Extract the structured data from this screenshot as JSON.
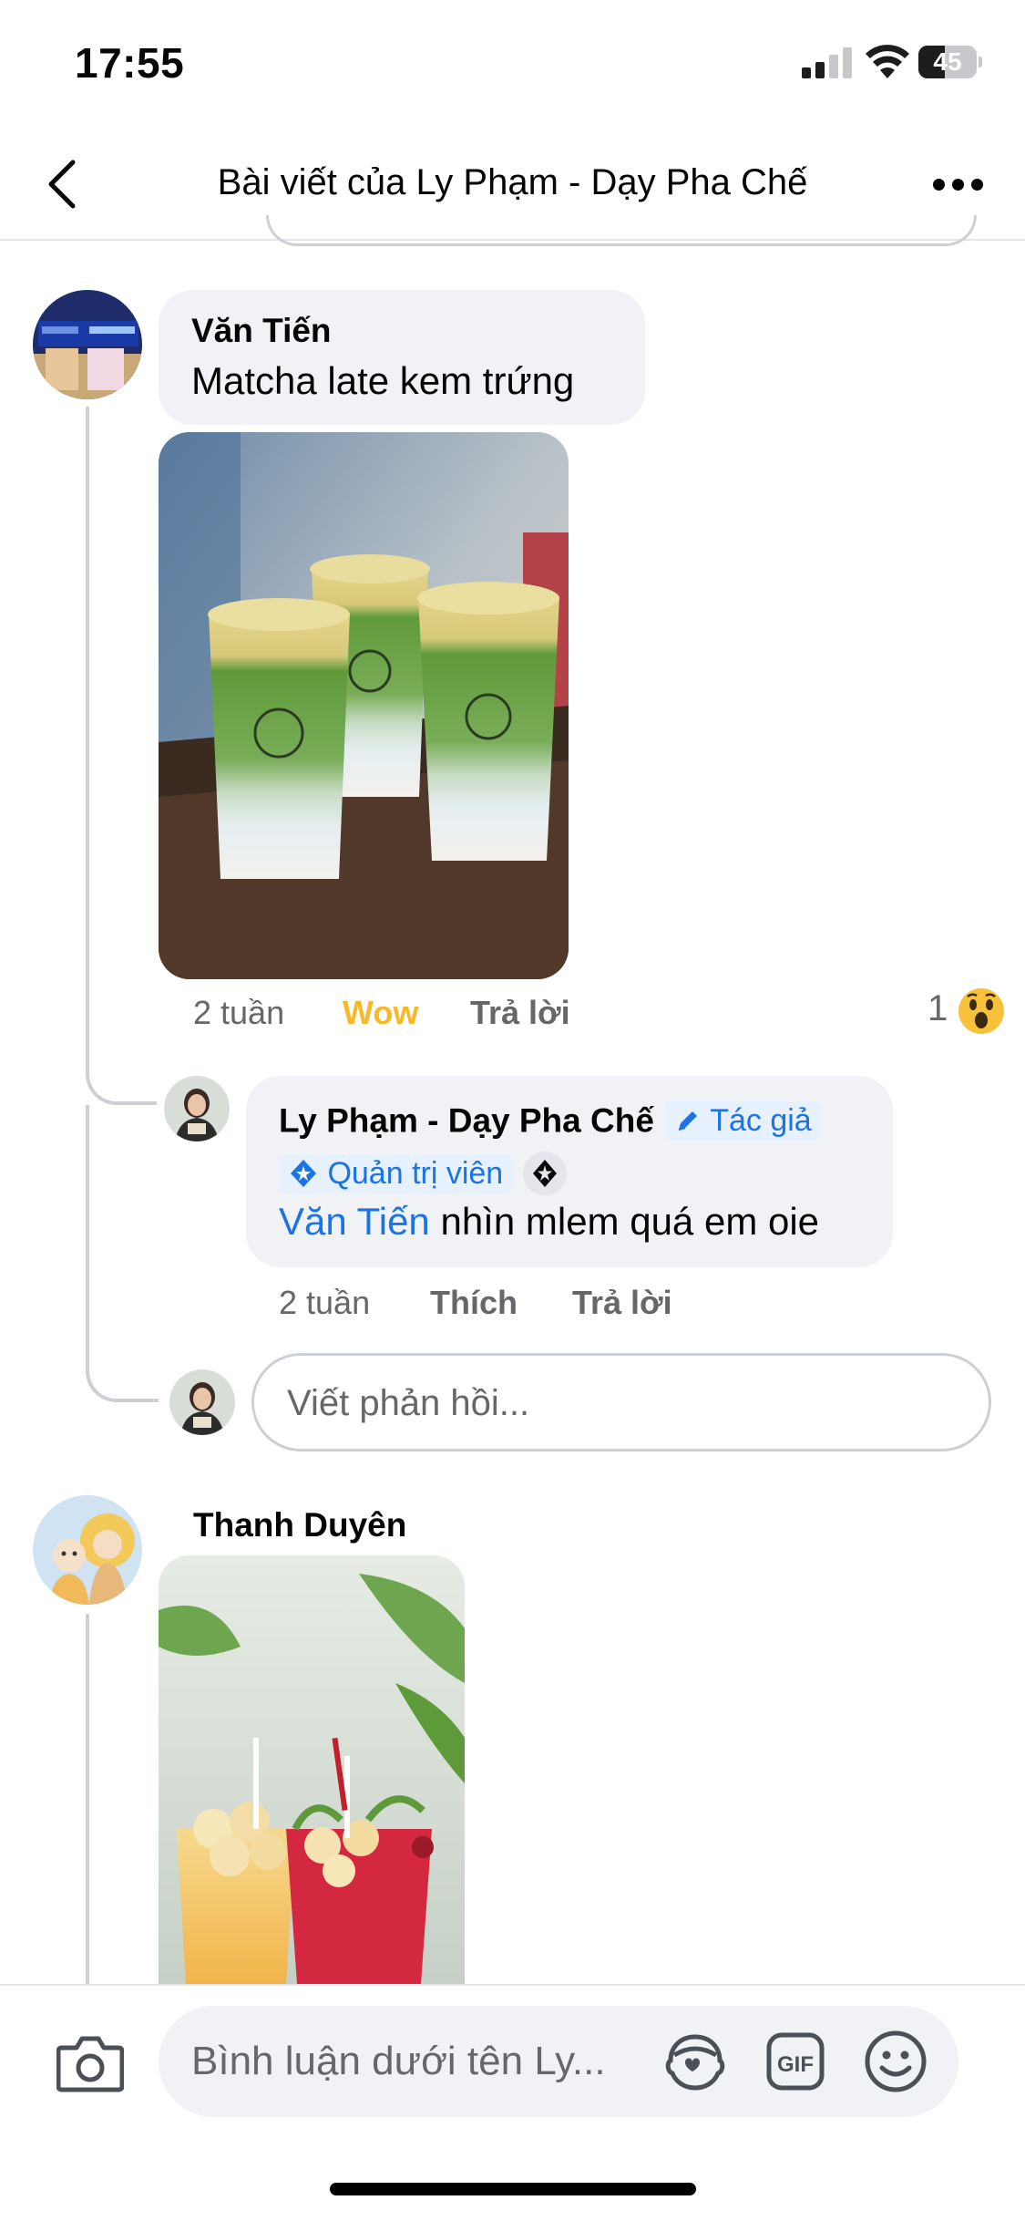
{
  "status_bar": {
    "time": "17:55",
    "battery": "45",
    "battery_level": 0.45
  },
  "header": {
    "title": "Bài viết của Ly Phạm - Dạy Pha Chế"
  },
  "comments": [
    {
      "author": "Văn Tiến",
      "text": "Matcha late kem trứng",
      "photo": "matcha-latte-cups-photo",
      "time": "2 tuần",
      "reaction_label": "Wow",
      "reply_label": "Trả lời",
      "reaction_count": "1",
      "reaction_icon": "wow-emoji-icon",
      "replies": [
        {
          "author": "Ly Phạm - Dạy Pha Chế",
          "author_badge": "Tác giả",
          "role_badge": "Quản trị viên",
          "mention": "Văn Tiến",
          "text": " nhìn mlem quá em oie",
          "time": "2 tuần",
          "like_label": "Thích",
          "reply_label": "Trả lời"
        }
      ],
      "reply_placeholder": "Viết phản hồi..."
    },
    {
      "author": "Thanh Duyên",
      "photo": "longan-drinks-photo"
    }
  ],
  "composer": {
    "placeholder": "Bình luận dưới tên Ly..."
  },
  "colors": {
    "link_blue": "#1b74e4",
    "wow_yellow": "#f7b928",
    "bubble_gray": "#f0f2f5",
    "meta_gray": "#65676b"
  }
}
